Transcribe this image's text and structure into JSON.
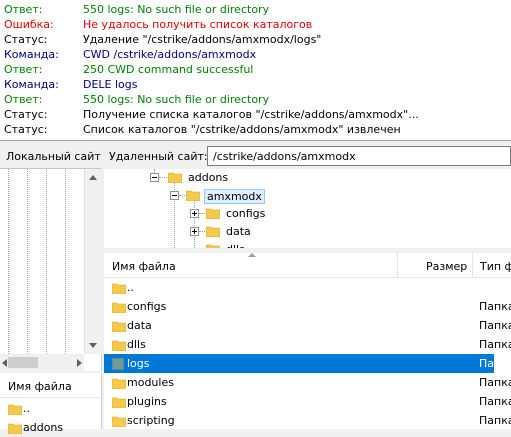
{
  "log": [
    {
      "label": "Ответ:",
      "message": "550 logs: No such file or directory",
      "kind": "ans"
    },
    {
      "label": "Ошибка:",
      "message": "Не удалось получить список каталогов",
      "kind": "err"
    },
    {
      "label": "Статус:",
      "message": "Удаление \"/cstrike/addons/amxmodx/logs\"",
      "kind": "st"
    },
    {
      "label": "Команда:",
      "message": "CWD /cstrike/addons/amxmodx",
      "kind": "cmd"
    },
    {
      "label": "Ответ:",
      "message": "250 CWD command successful",
      "kind": "ans"
    },
    {
      "label": "Команда:",
      "message": "DELE logs",
      "kind": "cmd"
    },
    {
      "label": "Ответ:",
      "message": "550 logs: No such file or directory",
      "kind": "ans"
    },
    {
      "label": "Статус:",
      "message": "Получение списка каталогов \"/cstrike/addons/amxmodx\"...",
      "kind": "st"
    },
    {
      "label": "Статус:",
      "message": "Список каталогов \"/cstrike/addons/amxmodx\" извлечен",
      "kind": "st"
    }
  ],
  "local": {
    "site_label": "Локальный сайт",
    "list_header_name": "Имя файла",
    "list_items": [
      "..",
      "addons"
    ]
  },
  "remote": {
    "site_label": "Удаленный сайт:",
    "path": "/cstrike/addons/amxmodx",
    "tree": [
      {
        "label": "addons",
        "expander": "minus"
      },
      {
        "label": "amxmodx",
        "expander": "minus",
        "selected": true
      },
      {
        "label": "configs",
        "expander": "plus"
      },
      {
        "label": "data",
        "expander": "plus"
      },
      {
        "label": "dlls",
        "expander": "none"
      }
    ],
    "list_header": {
      "name": "Имя файла",
      "size": "Размер",
      "type": "Тип фа"
    },
    "files": [
      {
        "name": "..",
        "type": ""
      },
      {
        "name": "configs",
        "type": "Папка"
      },
      {
        "name": "data",
        "type": "Папка"
      },
      {
        "name": "dlls",
        "type": "Папка"
      },
      {
        "name": "logs",
        "type": "Папка",
        "selected": true
      },
      {
        "name": "modules",
        "type": "Папка"
      },
      {
        "name": "plugins",
        "type": "Папка"
      },
      {
        "name": "scripting",
        "type": "Папка"
      }
    ]
  },
  "colors": {
    "answer": "#008000",
    "error": "#e00000",
    "command": "#000080",
    "selection": "#0078d7",
    "folder": "#f5c94b"
  },
  "icons": {
    "folder": "folder-icon",
    "logs_folder": "folder-teal-icon"
  }
}
